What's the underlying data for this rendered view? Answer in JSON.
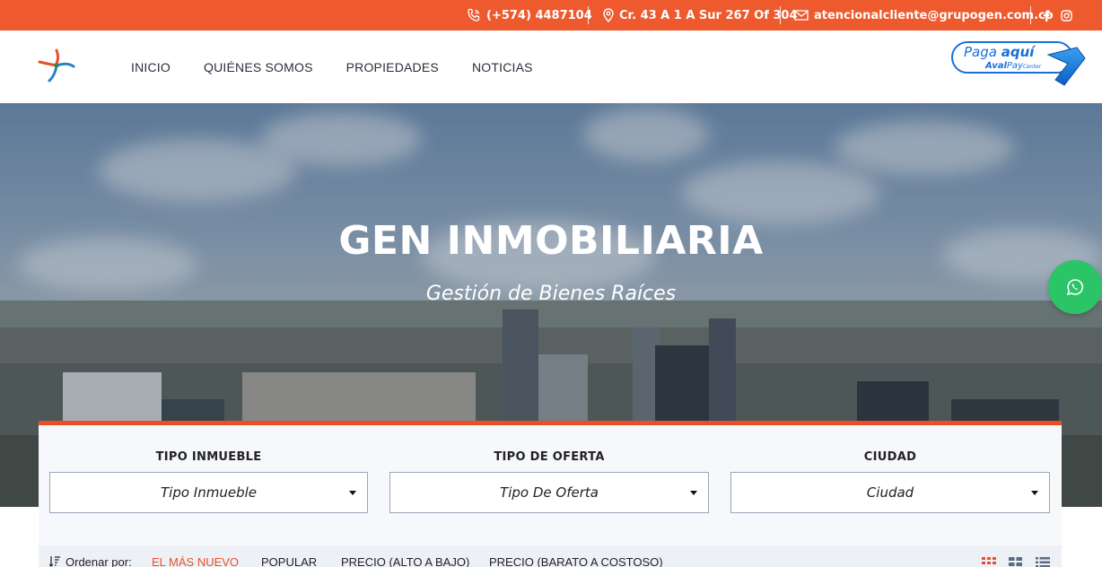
{
  "topbar": {
    "phone": "(+574) 4487104",
    "address": "Cr. 43 A 1 A Sur 267 Of 304",
    "email": "atencionalcliente@grupogen.com.co",
    "social": [
      "facebook-icon",
      "instagram-icon"
    ],
    "background": "#ee5a2d"
  },
  "nav": {
    "items": [
      "INICIO",
      "QUIÉNES SOMOS",
      "PROPIEDADES",
      "NOTICIAS"
    ]
  },
  "paybutton": {
    "line1a": "Paga ",
    "line1b": "aquí",
    "line2a": "Aval",
    "line2b": "Pay",
    "line2c": "Center"
  },
  "hero": {
    "title": "GEN INMOBILIARIA",
    "subtitle": "Gestión de Bienes Raíces"
  },
  "search": {
    "accent": "#e8502a",
    "fields": [
      {
        "label": "TIPO INMUEBLE",
        "value": "Tipo Inmueble"
      },
      {
        "label": "TIPO DE OFERTA",
        "value": "Tipo De Oferta"
      },
      {
        "label": "CIUDAD",
        "value": "Ciudad"
      }
    ]
  },
  "sort": {
    "label": "Ordenar por:",
    "options": [
      "EL MÁS NUEVO",
      "POPULAR",
      "PRECIO (ALTO A BAJO)",
      "PRECIO (BARATO A COSTOSO)"
    ],
    "active": "EL MÁS NUEVO",
    "views": [
      "grid-large-icon",
      "grid-small-icon",
      "list-icon"
    ]
  },
  "whatsapp": {
    "color": "#2bc466"
  }
}
